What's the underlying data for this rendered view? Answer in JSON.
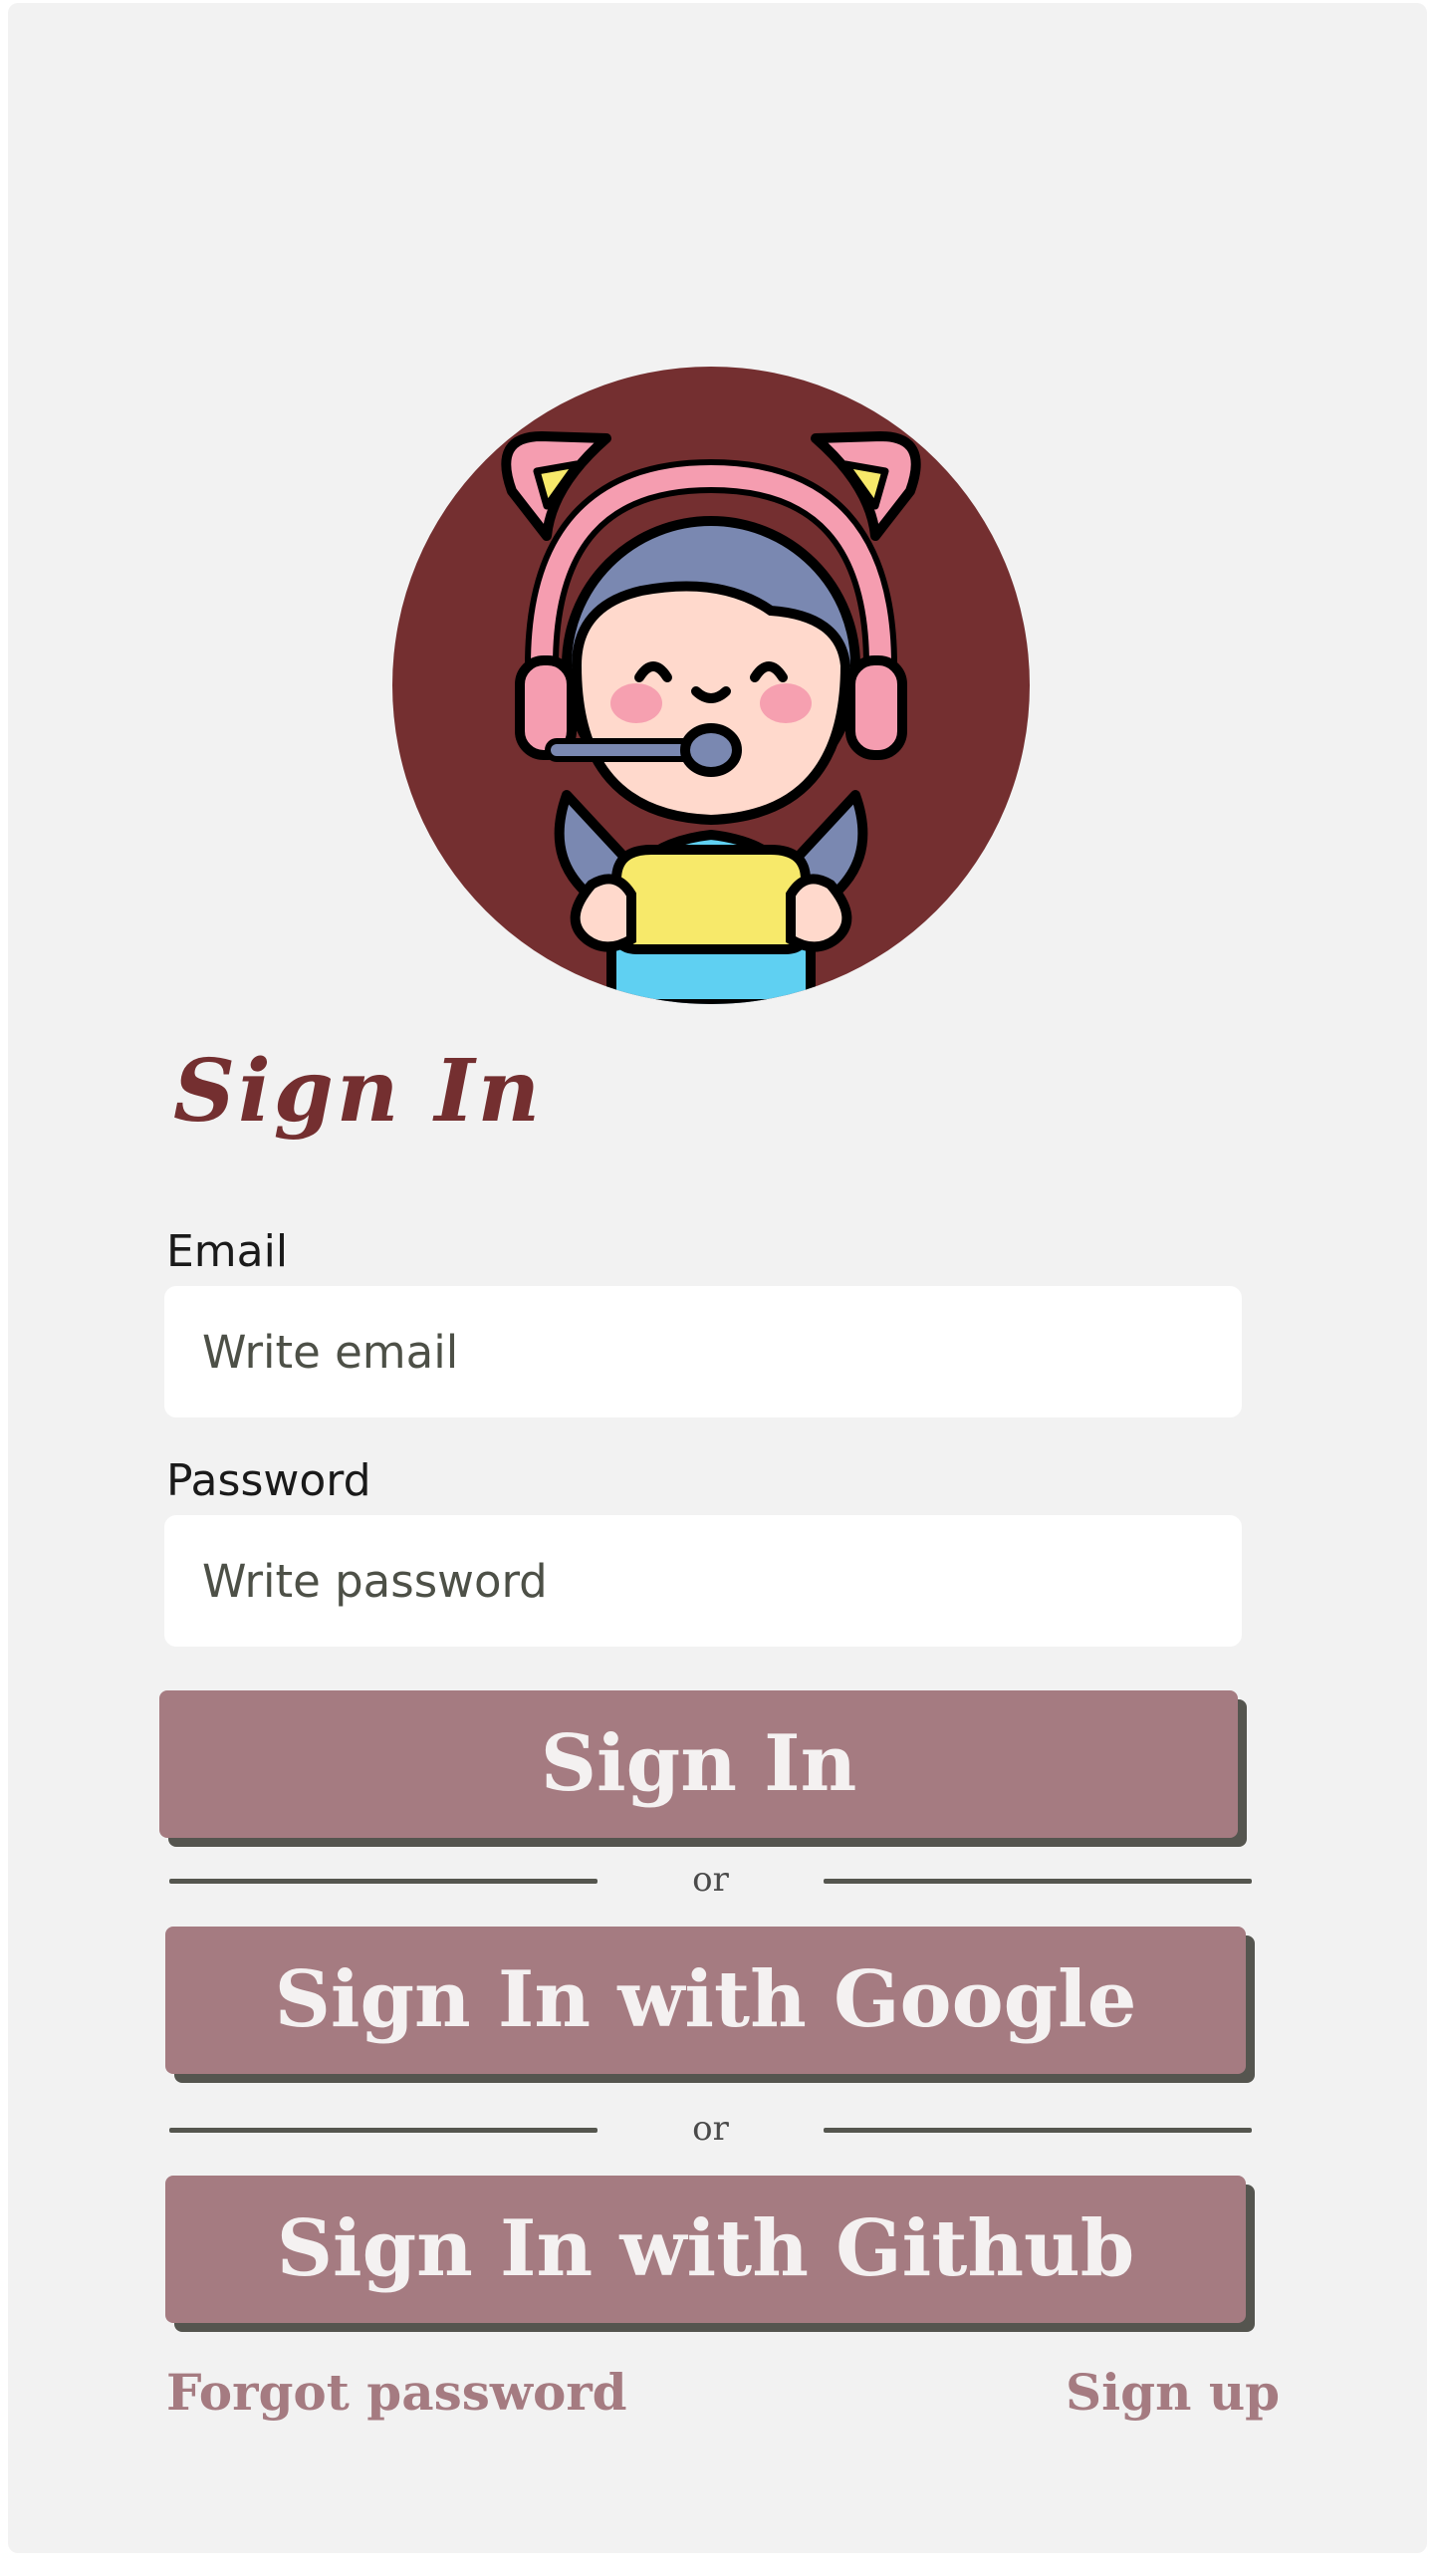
{
  "form": {
    "title": "Sign In",
    "email_label": "Email",
    "email_placeholder": "Write email",
    "password_label": "Password",
    "password_placeholder": "Write password"
  },
  "buttons": {
    "sign_in": "Sign In",
    "google": "Sign In with Google",
    "github": "Sign In with Github"
  },
  "dividers": {
    "or_1": "or",
    "or_2": "or"
  },
  "links": {
    "forgot_password": "Forgot password",
    "sign_up": "Sign up"
  },
  "colors": {
    "brand_maroon": "#742f30",
    "button_bg": "#a57b81",
    "button_shadow": "#55554f",
    "card_bg": "#f2f2f2"
  },
  "icons": {
    "avatar": "gamer-girl-with-headset-icon"
  }
}
